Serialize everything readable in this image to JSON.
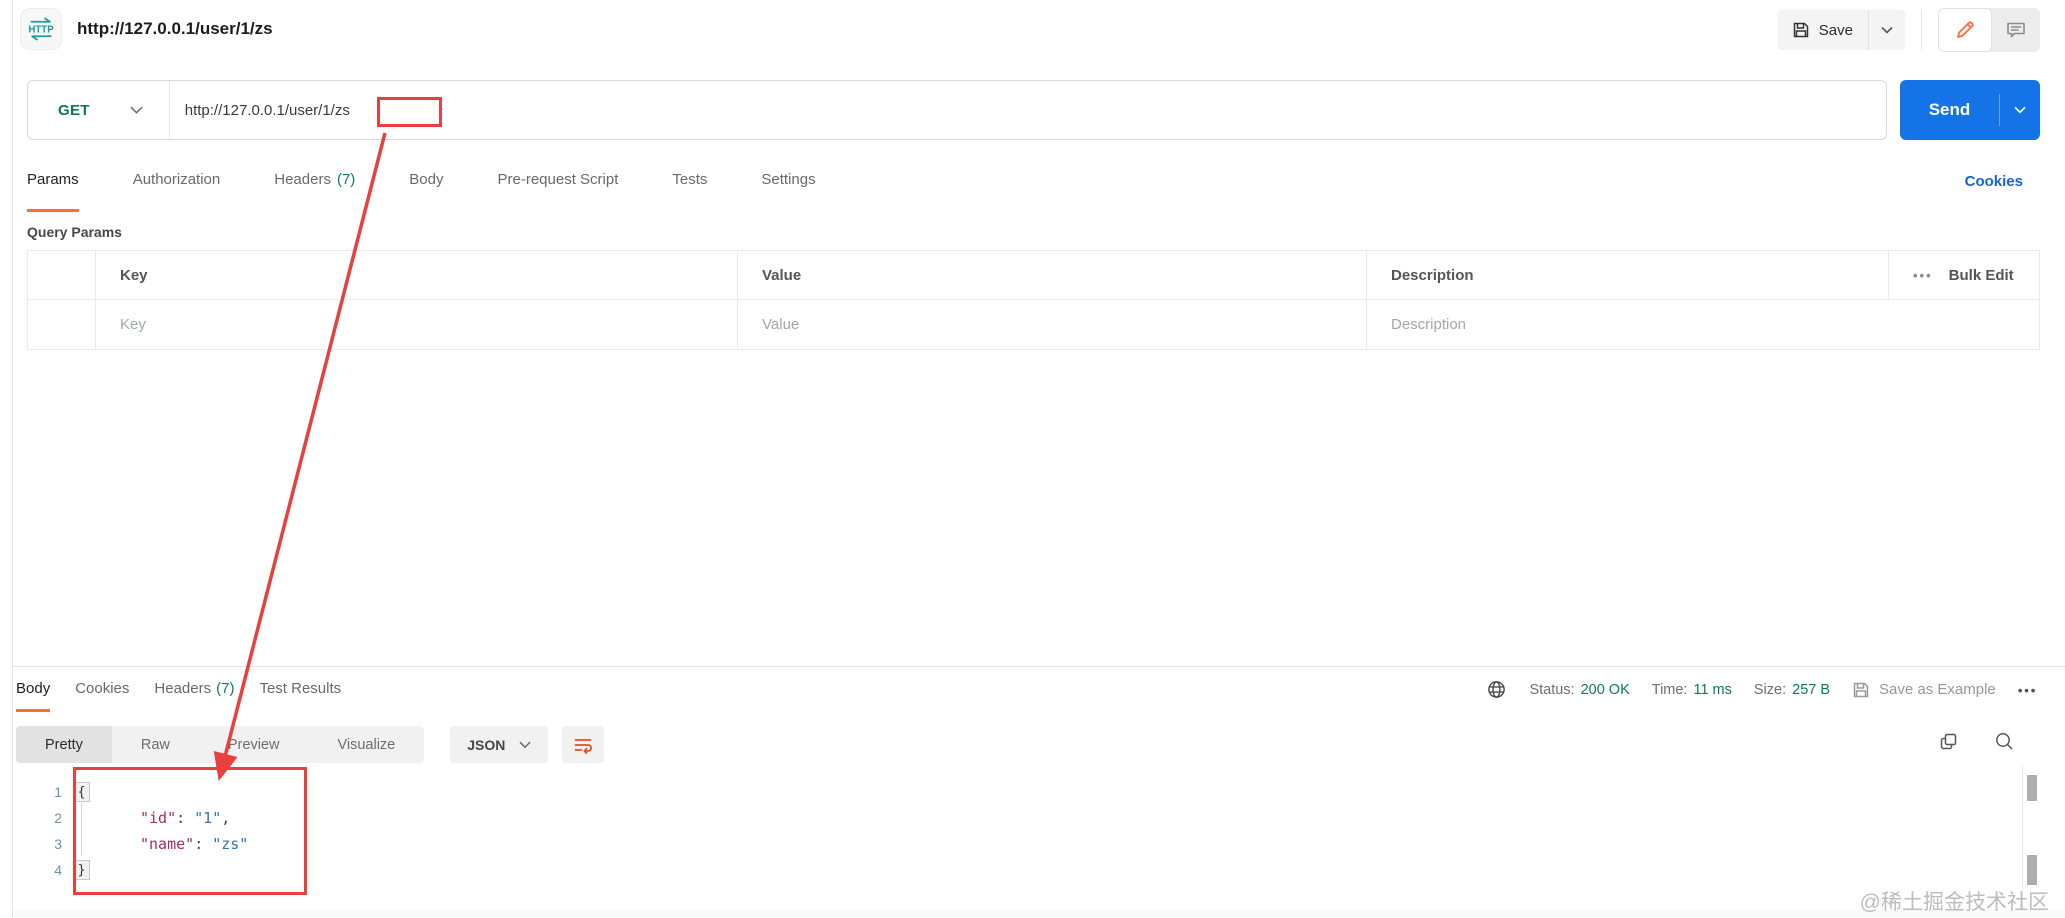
{
  "header": {
    "http_badge": "HTTP",
    "title": "http://127.0.0.1/user/1/zs",
    "save_label": "Save"
  },
  "request_bar": {
    "method": "GET",
    "url": "http://127.0.0.1/user/1/zs",
    "send_label": "Send"
  },
  "request_tabs": {
    "params": "Params",
    "authorization": "Authorization",
    "headers": "Headers",
    "headers_count": "(7)",
    "body": "Body",
    "prerequest": "Pre-request Script",
    "tests": "Tests",
    "settings": "Settings",
    "cookies_link": "Cookies"
  },
  "query_params": {
    "title": "Query Params",
    "col_key": "Key",
    "col_value": "Value",
    "col_description": "Description",
    "bulk_edit": "Bulk Edit",
    "dots": "•••",
    "ph_key": "Key",
    "ph_value": "Value",
    "ph_description": "Description"
  },
  "response": {
    "tab_body": "Body",
    "tab_cookies": "Cookies",
    "tab_headers": "Headers",
    "headers_count": "(7)",
    "tab_test_results": "Test Results",
    "status_label": "Status:",
    "status_value": "200 OK",
    "time_label": "Time:",
    "time_value": "11 ms",
    "size_label": "Size:",
    "size_value": "257 B",
    "save_as_example": "Save as Example",
    "more_dots": "•••",
    "view_pretty": "Pretty",
    "view_raw": "Raw",
    "view_preview": "Preview",
    "view_visualize": "Visualize",
    "format": "JSON"
  },
  "response_body": {
    "line_numbers": [
      "1",
      "2",
      "3",
      "4"
    ],
    "open_brace": "{",
    "close_brace": "}",
    "line2": {
      "key": "\"id\"",
      "colon": ":",
      "value": "\"1\"",
      "comma": ","
    },
    "line3": {
      "key": "\"name\"",
      "colon": ":",
      "value": "\"zs\""
    }
  },
  "watermark": "@稀土掘金技术社区",
  "colors": {
    "accent_orange": "#ff6c37",
    "method_green": "#0c7a4b",
    "status_green": "#0e7c4f",
    "send_blue": "#1473e6",
    "link_blue": "#1664d2",
    "annotation_red": "#e83f3f",
    "code_key": "#a62c63",
    "code_value": "#2e74b5"
  }
}
